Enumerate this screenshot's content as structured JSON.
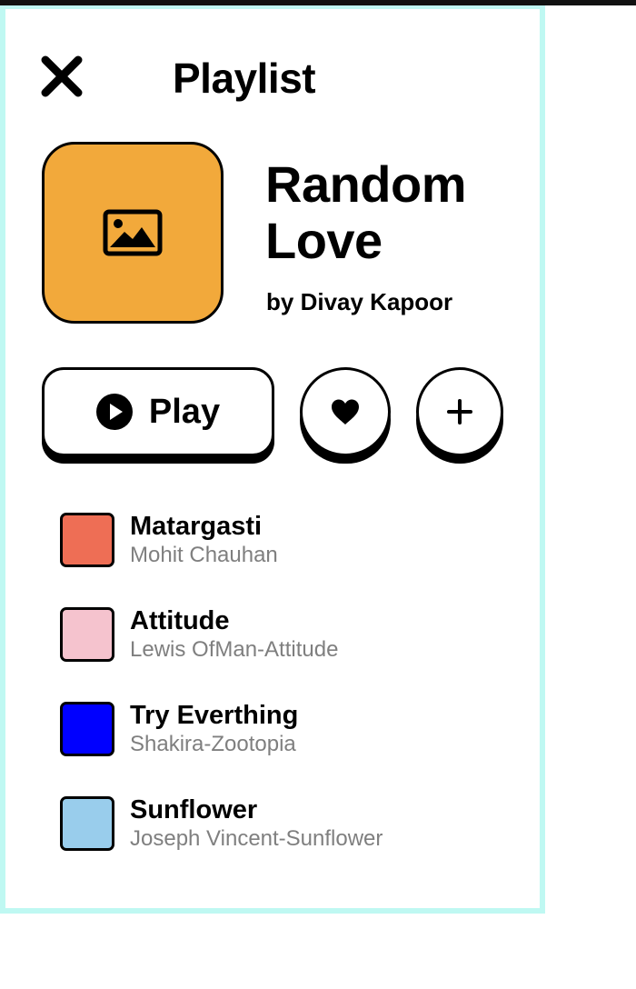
{
  "header": {
    "title": "Playlist"
  },
  "album": {
    "title": "Random Love",
    "byline": "by Divay Kapoor",
    "cover_color": "#f2a93b",
    "cover_icon": "image-icon"
  },
  "actions": {
    "play_label": "Play",
    "play_icon": "play-circle-icon",
    "like_icon": "heart-icon",
    "add_icon": "plus-icon"
  },
  "tracks": [
    {
      "title": "Matargasti",
      "artist": "Mohit Chauhan",
      "color": "#ee6e55"
    },
    {
      "title": "Attitude",
      "artist": "Lewis OfMan-Attitude",
      "color": "#f5c3ce"
    },
    {
      "title": "Try Everthing",
      "artist": "Shakira-Zootopia",
      "color": "#0000ff"
    },
    {
      "title": "Sunflower",
      "artist": "Joseph Vincent-Sunflower",
      "color": "#99cdec"
    }
  ],
  "colors": {
    "panel_border": "#bff8f2",
    "subtext": "#7f7f7f"
  }
}
